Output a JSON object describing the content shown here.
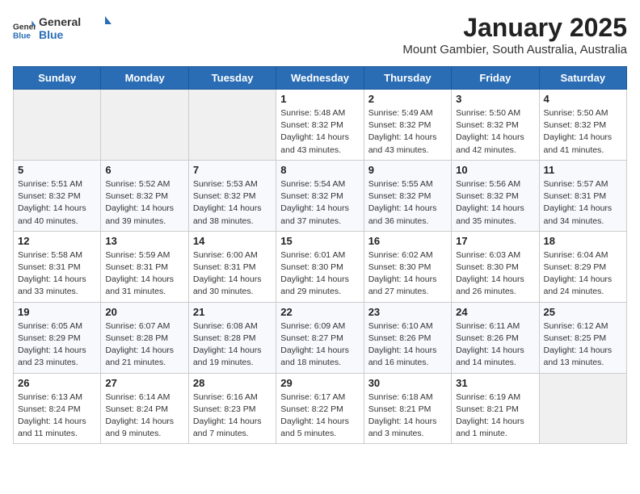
{
  "logo": {
    "general": "General",
    "blue": "Blue"
  },
  "header": {
    "title": "January 2025",
    "subtitle": "Mount Gambier, South Australia, Australia"
  },
  "weekdays": [
    "Sunday",
    "Monday",
    "Tuesday",
    "Wednesday",
    "Thursday",
    "Friday",
    "Saturday"
  ],
  "weeks": [
    [
      {
        "day": "",
        "info": ""
      },
      {
        "day": "",
        "info": ""
      },
      {
        "day": "",
        "info": ""
      },
      {
        "day": "1",
        "info": "Sunrise: 5:48 AM\nSunset: 8:32 PM\nDaylight: 14 hours\nand 43 minutes."
      },
      {
        "day": "2",
        "info": "Sunrise: 5:49 AM\nSunset: 8:32 PM\nDaylight: 14 hours\nand 43 minutes."
      },
      {
        "day": "3",
        "info": "Sunrise: 5:50 AM\nSunset: 8:32 PM\nDaylight: 14 hours\nand 42 minutes."
      },
      {
        "day": "4",
        "info": "Sunrise: 5:50 AM\nSunset: 8:32 PM\nDaylight: 14 hours\nand 41 minutes."
      }
    ],
    [
      {
        "day": "5",
        "info": "Sunrise: 5:51 AM\nSunset: 8:32 PM\nDaylight: 14 hours\nand 40 minutes."
      },
      {
        "day": "6",
        "info": "Sunrise: 5:52 AM\nSunset: 8:32 PM\nDaylight: 14 hours\nand 39 minutes."
      },
      {
        "day": "7",
        "info": "Sunrise: 5:53 AM\nSunset: 8:32 PM\nDaylight: 14 hours\nand 38 minutes."
      },
      {
        "day": "8",
        "info": "Sunrise: 5:54 AM\nSunset: 8:32 PM\nDaylight: 14 hours\nand 37 minutes."
      },
      {
        "day": "9",
        "info": "Sunrise: 5:55 AM\nSunset: 8:32 PM\nDaylight: 14 hours\nand 36 minutes."
      },
      {
        "day": "10",
        "info": "Sunrise: 5:56 AM\nSunset: 8:32 PM\nDaylight: 14 hours\nand 35 minutes."
      },
      {
        "day": "11",
        "info": "Sunrise: 5:57 AM\nSunset: 8:31 PM\nDaylight: 14 hours\nand 34 minutes."
      }
    ],
    [
      {
        "day": "12",
        "info": "Sunrise: 5:58 AM\nSunset: 8:31 PM\nDaylight: 14 hours\nand 33 minutes."
      },
      {
        "day": "13",
        "info": "Sunrise: 5:59 AM\nSunset: 8:31 PM\nDaylight: 14 hours\nand 31 minutes."
      },
      {
        "day": "14",
        "info": "Sunrise: 6:00 AM\nSunset: 8:31 PM\nDaylight: 14 hours\nand 30 minutes."
      },
      {
        "day": "15",
        "info": "Sunrise: 6:01 AM\nSunset: 8:30 PM\nDaylight: 14 hours\nand 29 minutes."
      },
      {
        "day": "16",
        "info": "Sunrise: 6:02 AM\nSunset: 8:30 PM\nDaylight: 14 hours\nand 27 minutes."
      },
      {
        "day": "17",
        "info": "Sunrise: 6:03 AM\nSunset: 8:30 PM\nDaylight: 14 hours\nand 26 minutes."
      },
      {
        "day": "18",
        "info": "Sunrise: 6:04 AM\nSunset: 8:29 PM\nDaylight: 14 hours\nand 24 minutes."
      }
    ],
    [
      {
        "day": "19",
        "info": "Sunrise: 6:05 AM\nSunset: 8:29 PM\nDaylight: 14 hours\nand 23 minutes."
      },
      {
        "day": "20",
        "info": "Sunrise: 6:07 AM\nSunset: 8:28 PM\nDaylight: 14 hours\nand 21 minutes."
      },
      {
        "day": "21",
        "info": "Sunrise: 6:08 AM\nSunset: 8:28 PM\nDaylight: 14 hours\nand 19 minutes."
      },
      {
        "day": "22",
        "info": "Sunrise: 6:09 AM\nSunset: 8:27 PM\nDaylight: 14 hours\nand 18 minutes."
      },
      {
        "day": "23",
        "info": "Sunrise: 6:10 AM\nSunset: 8:26 PM\nDaylight: 14 hours\nand 16 minutes."
      },
      {
        "day": "24",
        "info": "Sunrise: 6:11 AM\nSunset: 8:26 PM\nDaylight: 14 hours\nand 14 minutes."
      },
      {
        "day": "25",
        "info": "Sunrise: 6:12 AM\nSunset: 8:25 PM\nDaylight: 14 hours\nand 13 minutes."
      }
    ],
    [
      {
        "day": "26",
        "info": "Sunrise: 6:13 AM\nSunset: 8:24 PM\nDaylight: 14 hours\nand 11 minutes."
      },
      {
        "day": "27",
        "info": "Sunrise: 6:14 AM\nSunset: 8:24 PM\nDaylight: 14 hours\nand 9 minutes."
      },
      {
        "day": "28",
        "info": "Sunrise: 6:16 AM\nSunset: 8:23 PM\nDaylight: 14 hours\nand 7 minutes."
      },
      {
        "day": "29",
        "info": "Sunrise: 6:17 AM\nSunset: 8:22 PM\nDaylight: 14 hours\nand 5 minutes."
      },
      {
        "day": "30",
        "info": "Sunrise: 6:18 AM\nSunset: 8:21 PM\nDaylight: 14 hours\nand 3 minutes."
      },
      {
        "day": "31",
        "info": "Sunrise: 6:19 AM\nSunset: 8:21 PM\nDaylight: 14 hours\nand 1 minute."
      },
      {
        "day": "",
        "info": ""
      }
    ]
  ]
}
